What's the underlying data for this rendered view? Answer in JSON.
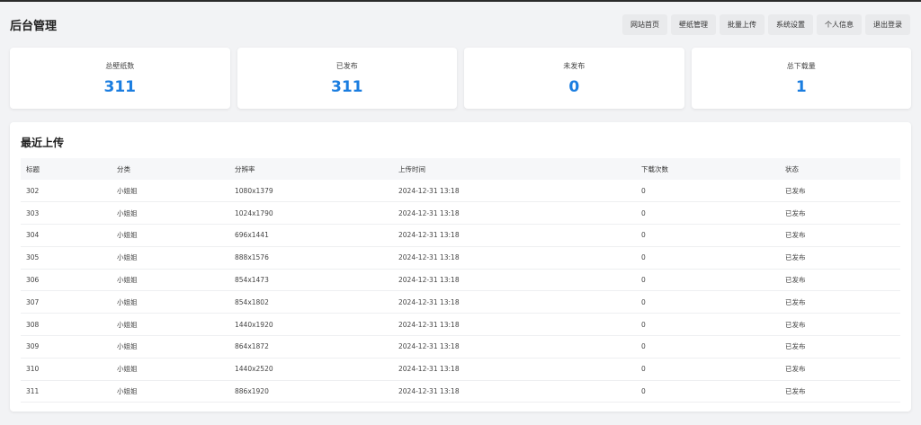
{
  "header": {
    "title": "后台管理",
    "nav": [
      "网站首页",
      "壁纸管理",
      "批量上传",
      "系统设置",
      "个人信息",
      "退出登录"
    ]
  },
  "stats": [
    {
      "label": "总壁纸数",
      "value": "311"
    },
    {
      "label": "已发布",
      "value": "311"
    },
    {
      "label": "未发布",
      "value": "0"
    },
    {
      "label": "总下载量",
      "value": "1"
    }
  ],
  "recent": {
    "title": "最近上传",
    "columns": [
      "标题",
      "分类",
      "分辨率",
      "上传时间",
      "下载次数",
      "状态"
    ],
    "rows": [
      [
        "302",
        "小姐姐",
        "1080x1379",
        "2024-12-31 13:18",
        "0",
        "已发布"
      ],
      [
        "303",
        "小姐姐",
        "1024x1790",
        "2024-12-31 13:18",
        "0",
        "已发布"
      ],
      [
        "304",
        "小姐姐",
        "696x1441",
        "2024-12-31 13:18",
        "0",
        "已发布"
      ],
      [
        "305",
        "小姐姐",
        "888x1576",
        "2024-12-31 13:18",
        "0",
        "已发布"
      ],
      [
        "306",
        "小姐姐",
        "854x1473",
        "2024-12-31 13:18",
        "0",
        "已发布"
      ],
      [
        "307",
        "小姐姐",
        "854x1802",
        "2024-12-31 13:18",
        "0",
        "已发布"
      ],
      [
        "308",
        "小姐姐",
        "1440x1920",
        "2024-12-31 13:18",
        "0",
        "已发布"
      ],
      [
        "309",
        "小姐姐",
        "864x1872",
        "2024-12-31 13:18",
        "0",
        "已发布"
      ],
      [
        "310",
        "小姐姐",
        "1440x2520",
        "2024-12-31 13:18",
        "0",
        "已发布"
      ],
      [
        "311",
        "小姐姐",
        "886x1920",
        "2024-12-31 13:18",
        "0",
        "已发布"
      ]
    ]
  },
  "colors": {
    "accent": "#1a7de0",
    "background": "#f2f3f5",
    "header_row": "#f6f7f9"
  }
}
